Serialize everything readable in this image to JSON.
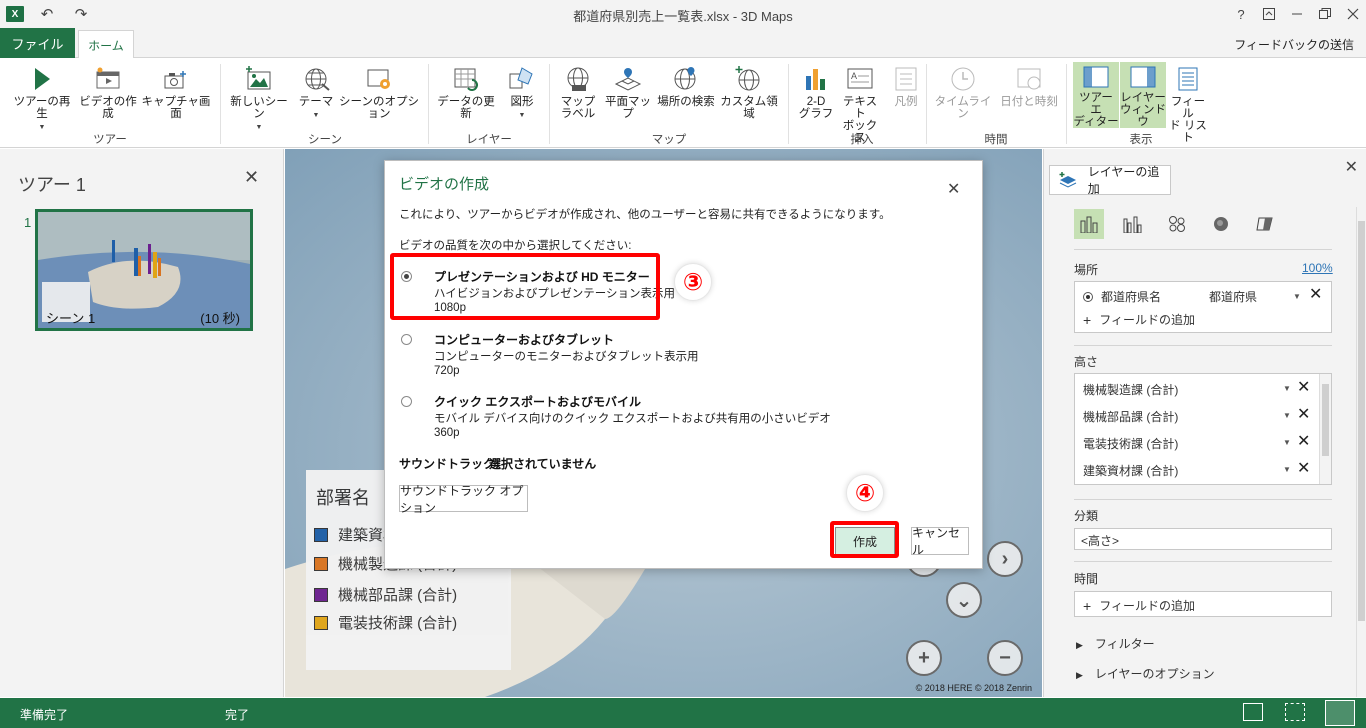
{
  "window": {
    "title": "都道府県別売上一覧表.xlsx - 3D Maps",
    "app_logo": "X",
    "undo_icon": "undo-icon",
    "redo_icon": "redo-icon",
    "help": "?"
  },
  "tabs": {
    "file": "ファイル",
    "home": "ホーム",
    "feedback": "フィードバックの送信"
  },
  "ribbon": {
    "tour": {
      "label": "ツアー",
      "play": "ツアーの再生",
      "video": "ビデオの作成",
      "capture": "キャプチャ画面"
    },
    "scene": {
      "label": "シーン",
      "new_scene": "新しいシーン",
      "theme": "テーマ",
      "scene_options": "シーンのオプション"
    },
    "layer": {
      "label": "レイヤー",
      "refresh": "データの更新",
      "shapes": "図形"
    },
    "map": {
      "label": "マップ",
      "map_labels_1": "マップ",
      "map_labels_2": "ラベル",
      "flat_map": "平面マップ",
      "find_location": "場所の検索",
      "custom_regions": "カスタム領域"
    },
    "insert": {
      "label": "挿入",
      "chart_1": "2-D",
      "chart_2": "グラフ",
      "textbox_1": "テキスト",
      "textbox_2": "ボックス",
      "legend": "凡例"
    },
    "time": {
      "label": "時間",
      "timeline": "タイムライン",
      "datetime": "日付と時刻"
    },
    "view": {
      "label": "表示",
      "tour_editor_1": "ツアー エ",
      "tour_editor_2": "ディター",
      "layer_pane_1": "レイヤー",
      "layer_pane_2": "ウィンドウ",
      "field_list_1": "フィール",
      "field_list_2": "ド リスト"
    }
  },
  "left_panel": {
    "tour_title": "ツアー 1",
    "scene_number": "1",
    "scene_name": "シーン 1",
    "scene_duration": "(10 秒)"
  },
  "map": {
    "copyright": "© 2018 HERE   © 2018 Zenrin",
    "legend": {
      "title": "部署名",
      "items": [
        {
          "label": "建築資材課 (合計)",
          "color": "#1f5fa8"
        },
        {
          "label": "機械製造課 (合計)",
          "color": "#d9731f"
        },
        {
          "label": "機械部品課 (合計)",
          "color": "#6b1f8f"
        },
        {
          "label": "電装技術課 (合計)",
          "color": "#e0a416"
        }
      ]
    }
  },
  "right_panel": {
    "add_layer": "レイヤーの追加",
    "location_label": "場所",
    "location_pct": "100%",
    "location_field": "都道府県名",
    "location_type": "都道府県",
    "add_field": "フィールドの追加",
    "height_label": "高さ",
    "height_fields": [
      "機械製造課 (合計)",
      "機械部品課 (合計)",
      "電装技術課 (合計)",
      "建築資材課 (合計)"
    ],
    "category_label": "分類",
    "category_value": "<高さ>",
    "time_label": "時間",
    "time_add_field": "フィールドの追加",
    "filter": "フィルター",
    "layer_options": "レイヤーのオプション"
  },
  "status": {
    "left": "準備完了",
    "middle": "完了"
  },
  "dialog": {
    "title": "ビデオの作成",
    "description": "これにより、ツアーからビデオが作成され、他のユーザーと容易に共有できるようになります。",
    "prompt": "ビデオの品質を次の中から選択してください:",
    "options": [
      {
        "name": "プレゼンテーションおよび HD モニター",
        "sub": "ハイビジョンおよびプレゼンテーション表示用",
        "res": "1080p",
        "selected": true
      },
      {
        "name": "コンピューターおよびタブレット",
        "sub": "コンピューターのモニターおよびタブレット表示用",
        "res": "720p",
        "selected": false
      },
      {
        "name": "クイック エクスポートおよびモバイル",
        "sub": "モバイル デバイス向けのクイック エクスポートおよび共有用の小さいビデオ",
        "res": "360p",
        "selected": false
      }
    ],
    "soundtrack_label": "サウンドトラック:",
    "soundtrack_value": "選択されていません",
    "soundtrack_button": "サウンドトラック オプション",
    "create": "作成",
    "cancel": "キャンセル"
  },
  "annotations": {
    "step3": "③",
    "step4": "④",
    "color": "#ff0000"
  },
  "colors": {
    "accent": "#217346",
    "active_bg": "#c6e0b4"
  }
}
